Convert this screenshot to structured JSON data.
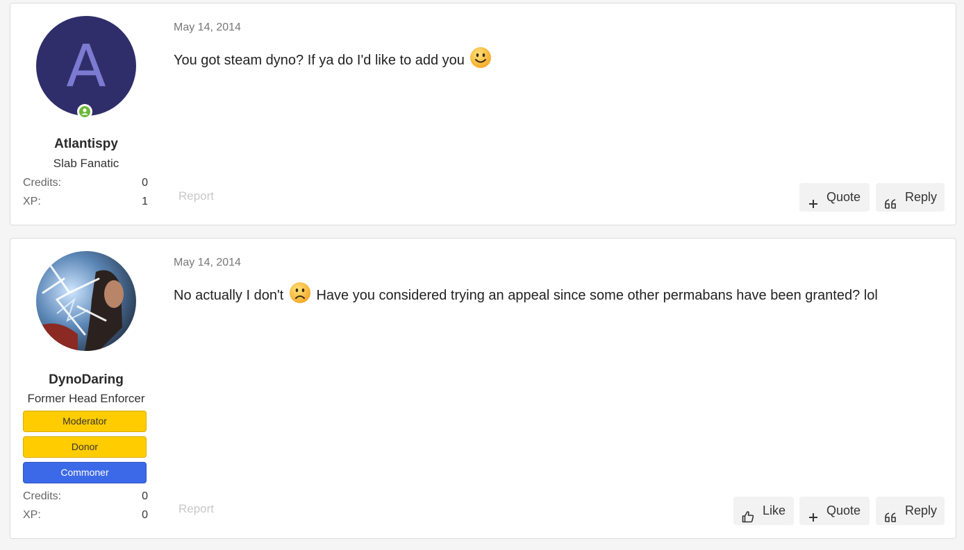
{
  "posts": [
    {
      "author": {
        "avatar_letter": "A",
        "username": "Atlantispy",
        "title": "Slab Fanatic",
        "stats": [
          {
            "label": "Credits:",
            "value": "0"
          },
          {
            "label": "XP:",
            "value": "1"
          }
        ],
        "online": true
      },
      "date": "May 14, 2014",
      "message_before": "You got steam dyno? If ya do I'd like to add you",
      "emoji": "smile-emoji",
      "report_label": "Report",
      "actions": {
        "quote": "Quote",
        "reply": "Reply"
      }
    },
    {
      "author": {
        "username": "DynoDaring",
        "title": "Former Head Enforcer",
        "badges": [
          "Moderator",
          "Donor",
          "Commoner"
        ],
        "stats": [
          {
            "label": "Credits:",
            "value": "0"
          },
          {
            "label": "XP:",
            "value": "0"
          }
        ]
      },
      "date": "May 14, 2014",
      "message_before": "No actually I don't",
      "message_after": "Have you considered trying an appeal since some other permabans have been granted? lol",
      "emoji": "frown-emoji",
      "report_label": "Report",
      "actions": {
        "like": "Like",
        "quote": "Quote",
        "reply": "Reply"
      }
    }
  ],
  "colors": {
    "badge_yellow": "#ffcc00",
    "badge_blue": "#3c69e7",
    "online": "#6cb83a",
    "avatar_bg": "#2f2e6a"
  }
}
